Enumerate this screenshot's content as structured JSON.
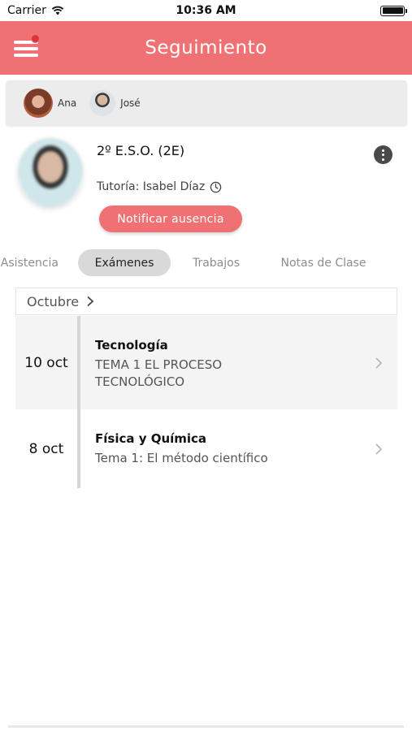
{
  "status_bar": {
    "carrier": "Carrier",
    "time": "10:36 AM"
  },
  "header": {
    "title": "Seguimiento"
  },
  "students": [
    {
      "name": "Ana"
    },
    {
      "name": "José"
    }
  ],
  "profile": {
    "class_name": "2º E.S.O. (2E)",
    "tutor": "Tutoría: Isabel Díaz",
    "notify_button": "Notificar ausencia"
  },
  "tabs": [
    {
      "label": "Asistencia"
    },
    {
      "label": "Exámenes",
      "selected": true
    },
    {
      "label": "Trabajos"
    },
    {
      "label": "Notas de Clase"
    }
  ],
  "month": {
    "label": "Octubre"
  },
  "exams": [
    {
      "date": "10 oct",
      "subject": "Tecnología",
      "topic": "TEMA 1 EL PROCESO TECNOLÓGICO"
    },
    {
      "date": "8 oct",
      "subject": "Física y Química",
      "topic": "Tema 1: El método científico"
    }
  ],
  "colors": {
    "accent": "#f07173",
    "badge": "#d9363a",
    "tab_selected_bg": "#d9d9d9"
  }
}
